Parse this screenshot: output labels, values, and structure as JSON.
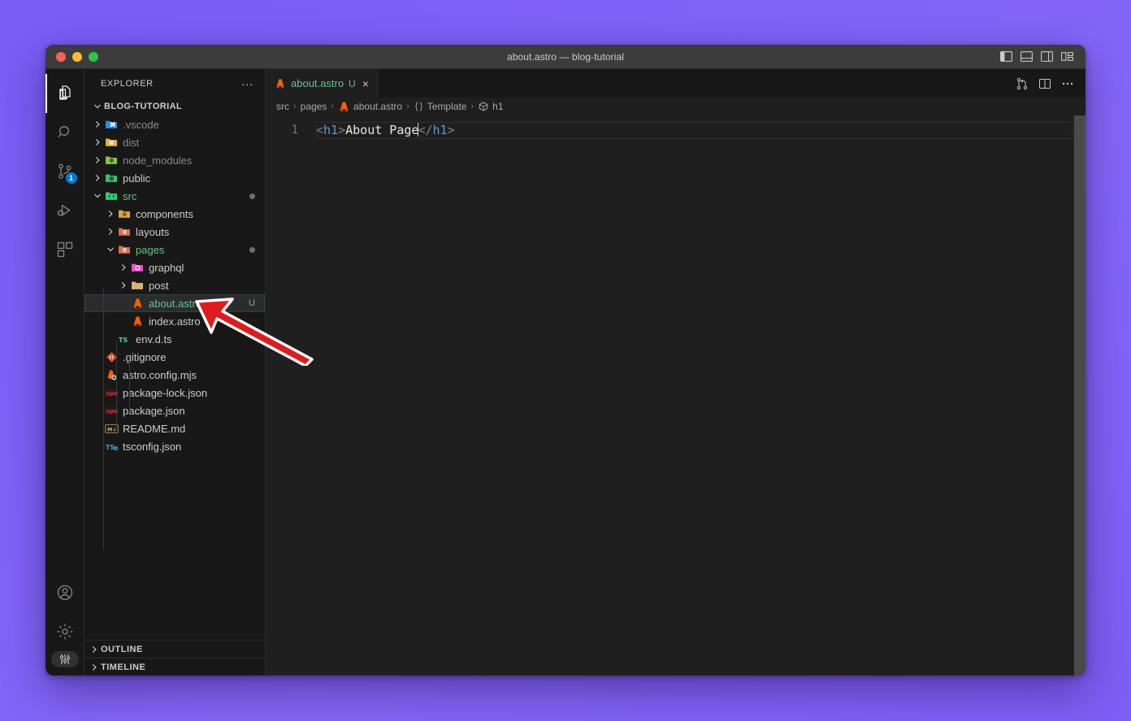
{
  "window": {
    "title": "about.astro — blog-tutorial",
    "traffic_lights": [
      "close",
      "minimize",
      "maximize"
    ],
    "layout_icons": [
      "toggle-primary-sidebar",
      "toggle-panel",
      "toggle-secondary-sidebar",
      "customize-layout"
    ]
  },
  "activity_bar": {
    "items": [
      {
        "name": "explorer",
        "icon": "files-icon",
        "active": true,
        "badge": ""
      },
      {
        "name": "search",
        "icon": "search-icon",
        "active": false,
        "badge": ""
      },
      {
        "name": "source-control",
        "icon": "source-control-icon",
        "active": false,
        "badge": "1"
      },
      {
        "name": "run-and-debug",
        "icon": "run-debug-icon",
        "active": false,
        "badge": ""
      },
      {
        "name": "extensions",
        "icon": "extensions-icon",
        "active": false,
        "badge": ""
      }
    ],
    "bottom_items": [
      {
        "name": "accounts",
        "icon": "account-icon"
      },
      {
        "name": "manage",
        "icon": "gear-icon"
      },
      {
        "name": "settings-pill",
        "icon": "sliders-icon"
      }
    ]
  },
  "sidebar": {
    "header": "EXPLORER",
    "more_actions": "...",
    "root": "BLOG-TUTORIAL",
    "tree": [
      {
        "label": ".vscode",
        "depth": 1,
        "type": "folder",
        "state": "collapsed",
        "icon": "folder-vscode-icon",
        "color": "dim",
        "modified": false,
        "badge": ""
      },
      {
        "label": "dist",
        "depth": 1,
        "type": "folder",
        "state": "collapsed",
        "icon": "folder-dist-icon",
        "color": "dim",
        "modified": false,
        "badge": ""
      },
      {
        "label": "node_modules",
        "depth": 1,
        "type": "folder",
        "state": "collapsed",
        "icon": "folder-node-icon",
        "color": "dim",
        "modified": false,
        "badge": ""
      },
      {
        "label": "public",
        "depth": 1,
        "type": "folder",
        "state": "collapsed",
        "icon": "folder-public-icon",
        "color": "white",
        "modified": false,
        "badge": ""
      },
      {
        "label": "src",
        "depth": 1,
        "type": "folder",
        "state": "expanded",
        "icon": "folder-src-icon",
        "color": "green",
        "modified": true,
        "badge": ""
      },
      {
        "label": "components",
        "depth": 2,
        "type": "folder",
        "state": "collapsed",
        "icon": "folder-components-icon",
        "color": "white",
        "modified": false,
        "badge": ""
      },
      {
        "label": "layouts",
        "depth": 2,
        "type": "folder",
        "state": "collapsed",
        "icon": "folder-layouts-icon",
        "color": "white",
        "modified": false,
        "badge": ""
      },
      {
        "label": "pages",
        "depth": 2,
        "type": "folder",
        "state": "expanded",
        "icon": "folder-pages-icon",
        "color": "green",
        "modified": true,
        "badge": ""
      },
      {
        "label": "graphql",
        "depth": 3,
        "type": "folder",
        "state": "collapsed",
        "icon": "folder-graphql-icon",
        "color": "white",
        "modified": false,
        "badge": ""
      },
      {
        "label": "post",
        "depth": 3,
        "type": "folder",
        "state": "collapsed",
        "icon": "folder-post-icon",
        "color": "white",
        "modified": false,
        "badge": ""
      },
      {
        "label": "about.astro",
        "depth": 3,
        "type": "file",
        "state": "",
        "icon": "astro-file-icon",
        "color": "green",
        "modified": false,
        "badge": "U",
        "selected": true
      },
      {
        "label": "index.astro",
        "depth": 3,
        "type": "file",
        "state": "",
        "icon": "astro-file-icon",
        "color": "white",
        "modified": false,
        "badge": ""
      },
      {
        "label": "env.d.ts",
        "depth": 2,
        "type": "file",
        "state": "",
        "icon": "typescript-def-icon",
        "color": "white",
        "modified": false,
        "badge": ""
      },
      {
        "label": ".gitignore",
        "depth": 1,
        "type": "file",
        "state": "",
        "icon": "git-icon",
        "color": "white",
        "modified": false,
        "badge": ""
      },
      {
        "label": "astro.config.mjs",
        "depth": 1,
        "type": "file",
        "state": "",
        "icon": "astro-config-icon",
        "color": "white",
        "modified": false,
        "badge": ""
      },
      {
        "label": "package-lock.json",
        "depth": 1,
        "type": "file",
        "state": "",
        "icon": "npm-lock-icon",
        "color": "white",
        "modified": false,
        "badge": ""
      },
      {
        "label": "package.json",
        "depth": 1,
        "type": "file",
        "state": "",
        "icon": "npm-icon",
        "color": "white",
        "modified": false,
        "badge": ""
      },
      {
        "label": "README.md",
        "depth": 1,
        "type": "file",
        "state": "",
        "icon": "markdown-icon",
        "color": "white",
        "modified": false,
        "badge": ""
      },
      {
        "label": "tsconfig.json",
        "depth": 1,
        "type": "file",
        "state": "",
        "icon": "tsconfig-icon",
        "color": "white",
        "modified": false,
        "badge": ""
      }
    ],
    "sections": [
      {
        "label": "OUTLINE",
        "state": "collapsed"
      },
      {
        "label": "TIMELINE",
        "state": "collapsed"
      }
    ]
  },
  "editor": {
    "tab": {
      "label": "about.astro",
      "dirty_badge": "U",
      "icon": "astro-file-icon",
      "close": "×"
    },
    "tab_actions": [
      "split-editor-vertical-icon",
      "split-editor-icon",
      "more-actions-icon"
    ],
    "breadcrumb": [
      {
        "label": "src",
        "icon": ""
      },
      {
        "label": "pages",
        "icon": ""
      },
      {
        "label": "about.astro",
        "icon": "astro-file-icon"
      },
      {
        "label": "Template",
        "icon": "braces-icon"
      },
      {
        "label": "h1",
        "icon": "symbol-field-icon"
      }
    ],
    "breadcrumb_separator": "›",
    "lines": [
      {
        "number": "1",
        "tokens": [
          {
            "text": "<",
            "kind": "punct"
          },
          {
            "text": "h1",
            "kind": "tag"
          },
          {
            "text": ">",
            "kind": "punct"
          },
          {
            "text": "About Page",
            "kind": "text"
          },
          {
            "text": "</",
            "kind": "punct"
          },
          {
            "text": "h1",
            "kind": "tag"
          },
          {
            "text": ">",
            "kind": "punct"
          }
        ]
      }
    ],
    "cursor_after_token_index": 3
  },
  "annotation": {
    "type": "arrow",
    "color": "#e01b1b",
    "outline": "#ffffff",
    "points_to": "about.astro"
  },
  "colors": {
    "background_gradient_start": "#7a5cf7",
    "background_gradient_end": "#7d5ef6",
    "titlebar": "#3c3c3c",
    "activitybar": "#181818",
    "sidebar": "#181818",
    "editor": "#1f1f1f",
    "accent_blue": "#0078d4",
    "tag_blue": "#569cd6",
    "green_text": "#6bbf8a",
    "badge_blue": "#0078d4"
  }
}
